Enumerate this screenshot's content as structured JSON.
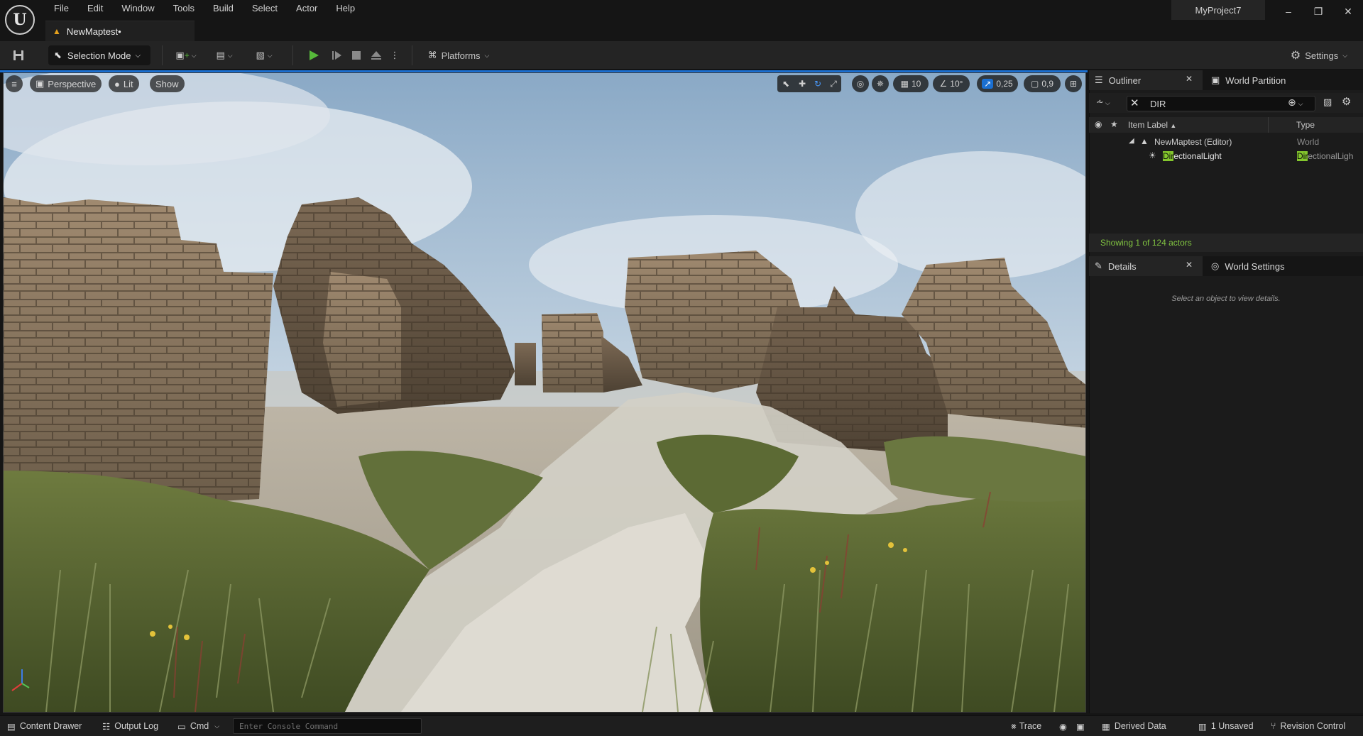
{
  "app": {
    "project_name": "MyProject7",
    "level_tab": "NewMaptest•"
  },
  "menu": [
    "File",
    "Edit",
    "Window",
    "Tools",
    "Build",
    "Select",
    "Actor",
    "Help"
  ],
  "toolbar": {
    "selection_mode": "Selection Mode",
    "platforms": "Platforms",
    "settings": "Settings"
  },
  "viewport": {
    "perspective": "Perspective",
    "lit": "Lit",
    "show": "Show",
    "grid_value": "10",
    "angle_value": "10°",
    "scale_value": "0,25",
    "camera_value": "0,9"
  },
  "outliner": {
    "tab_label": "Outliner",
    "tab2_label": "World Partition",
    "search_value": "DIR",
    "col_label": "Item Label",
    "col_type": "Type",
    "rows": [
      {
        "label": "NewMaptest (Editor)",
        "type": "World"
      },
      {
        "label_hl": "Dir",
        "label_rest": "ectionalLight",
        "type_hl": "Dir",
        "type_rest": "ectionalLigh"
      }
    ],
    "status": "Showing 1 of 124 actors"
  },
  "details": {
    "tab_label": "Details",
    "tab2_label": "World Settings",
    "empty_text": "Select an object to view details."
  },
  "bottombar": {
    "content_drawer": "Content Drawer",
    "output_log": "Output Log",
    "cmd": "Cmd",
    "console_placeholder": "Enter Console Command",
    "trace": "Trace",
    "derived_data": "Derived Data",
    "unsaved": "1 Unsaved",
    "revision_control": "Revision Control"
  },
  "colors": {
    "accent_blue": "#1a6fd1",
    "status_green": "#80c341",
    "play_green": "#56b83a"
  }
}
